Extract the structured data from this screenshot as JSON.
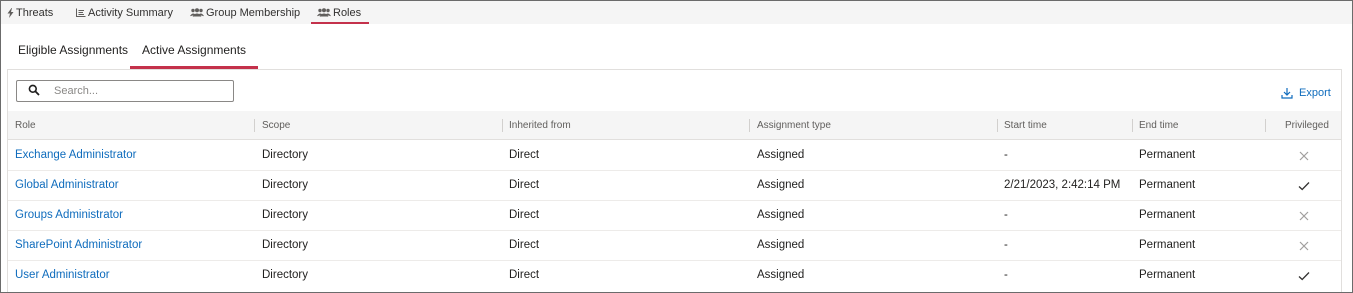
{
  "top_tabs": [
    {
      "label": "Threats",
      "icon": "bolt-icon"
    },
    {
      "label": "Activity Summary",
      "icon": "list-icon"
    },
    {
      "label": "Group Membership",
      "icon": "group-icon"
    },
    {
      "label": "Roles",
      "icon": "group-icon",
      "active": true
    }
  ],
  "sub_tabs": [
    {
      "label": "Eligible Assignments"
    },
    {
      "label": "Active Assignments",
      "active": true
    }
  ],
  "search": {
    "placeholder": "Search...",
    "value": ""
  },
  "export": {
    "label": "Export",
    "icon": "download-icon"
  },
  "table": {
    "columns": [
      "Role",
      "Scope",
      "Inherited from",
      "Assignment type",
      "Start time",
      "End time",
      "Privileged"
    ],
    "rows": [
      {
        "role": "Exchange Administrator",
        "scope": "Directory",
        "inherited_from": "Direct",
        "assignment_type": "Assigned",
        "start_time": "-",
        "end_time": "Permanent",
        "privileged": "x-icon"
      },
      {
        "role": "Global Administrator",
        "scope": "Directory",
        "inherited_from": "Direct",
        "assignment_type": "Assigned",
        "start_time": "2/21/2023, 2:42:14 PM",
        "end_time": "Permanent",
        "privileged": "check-icon"
      },
      {
        "role": "Groups Administrator",
        "scope": "Directory",
        "inherited_from": "Direct",
        "assignment_type": "Assigned",
        "start_time": "-",
        "end_time": "Permanent",
        "privileged": "x-icon"
      },
      {
        "role": "SharePoint Administrator",
        "scope": "Directory",
        "inherited_from": "Direct",
        "assignment_type": "Assigned",
        "start_time": "-",
        "end_time": "Permanent",
        "privileged": "x-icon"
      },
      {
        "role": "User Administrator",
        "scope": "Directory",
        "inherited_from": "Direct",
        "assignment_type": "Assigned",
        "start_time": "-",
        "end_time": "Permanent",
        "privileged": "check-icon"
      }
    ]
  },
  "colors": {
    "accent": "#c4314b",
    "link": "#0f6cbd"
  }
}
